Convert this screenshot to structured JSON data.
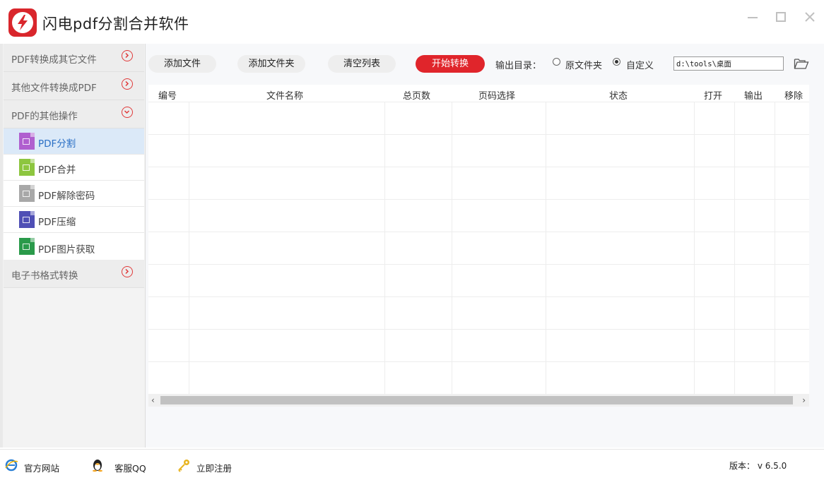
{
  "app": {
    "title": "闪电pdf分割合并软件",
    "window_controls": [
      "minimize",
      "maximize",
      "close"
    ]
  },
  "sidebar": {
    "sections": [
      {
        "label": "PDF转换成其它文件",
        "expanded": false
      },
      {
        "label": "其他文件转换成PDF",
        "expanded": false
      },
      {
        "label": "PDF的其他操作",
        "expanded": true
      },
      {
        "label": "电子书格式转换",
        "expanded": false
      }
    ],
    "subitems": [
      {
        "label": "PDF分割",
        "icon": "split-file-icon",
        "color": "#b05fcf",
        "active": true
      },
      {
        "label": "PDF合并",
        "icon": "merge-file-icon",
        "color": "#8dc63f",
        "active": false
      },
      {
        "label": "PDF解除密码",
        "icon": "unlock-file-icon",
        "color": "#a8a8a8",
        "active": false
      },
      {
        "label": "PDF压缩",
        "icon": "compress-file-icon",
        "color": "#4f4fb5",
        "active": false
      },
      {
        "label": "PDF图片获取",
        "icon": "image-file-icon",
        "color": "#2a9a4a",
        "active": false
      }
    ]
  },
  "toolbar": {
    "add_file": "添加文件",
    "add_folder": "添加文件夹",
    "clear_list": "清空列表",
    "start": "开始转换",
    "output_label": "输出目录：",
    "option_original": "原文件夹",
    "option_custom": "自定义",
    "selected_option": "自定义",
    "output_path": "d:\\tools\\桌面"
  },
  "table": {
    "columns": [
      "编号",
      "文件名称",
      "总页数",
      "页码选择",
      "状态",
      "打开",
      "输出",
      "移除"
    ],
    "rows": []
  },
  "footer": {
    "website": "官方网站",
    "support": "客服QQ",
    "register": "立即注册",
    "version": "版本： v 6.5.0"
  },
  "colors": {
    "accent_red": "#e0252b",
    "active_item_bg": "#dbe9f8",
    "active_item_text": "#2a6fc5"
  }
}
